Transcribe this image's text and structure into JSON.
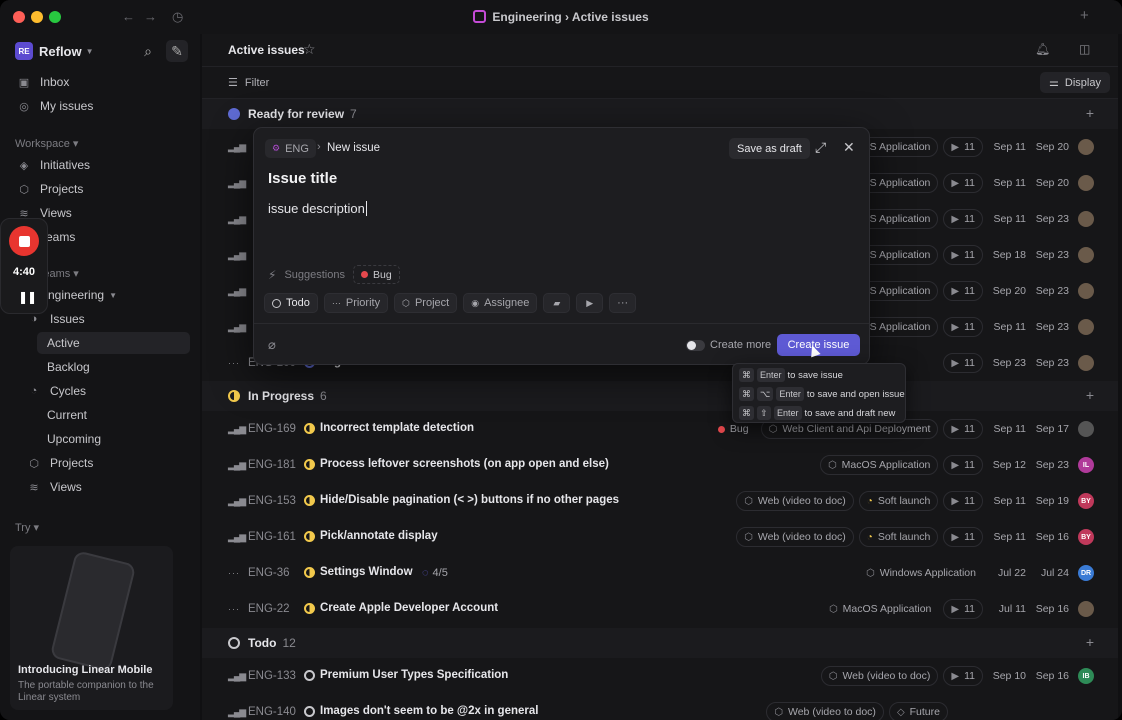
{
  "window": {
    "title": "Engineering › Active issues"
  },
  "sidebar": {
    "workspace_badge": "RE",
    "workspace_name": "Reflow",
    "inbox": "Inbox",
    "my_issues": "My issues",
    "workspace_section": "Workspace",
    "initiatives": "Initiatives",
    "projects": "Projects",
    "views": "Views",
    "teams": "Teams",
    "your_teams_section": "Your teams",
    "team_name": "Engineering",
    "issues": "Issues",
    "active": "Active",
    "backlog": "Backlog",
    "cycles": "Cycles",
    "current": "Current",
    "upcoming": "Upcoming",
    "team_projects": "Projects",
    "team_views": "Views",
    "try_section": "Try",
    "promo_title": "Introducing Linear Mobile",
    "promo_sub": "The portable companion to the Linear system"
  },
  "recorder": {
    "time": "4:40"
  },
  "header": {
    "title": "Active issues",
    "filter": "Filter",
    "display": "Display"
  },
  "groups": {
    "review": {
      "label": "Ready for review",
      "count": "7"
    },
    "progress": {
      "label": "In Progress",
      "count": "6"
    },
    "todo": {
      "label": "Todo",
      "count": "12"
    }
  },
  "review_rows": [
    {
      "project": "MacOS Application",
      "est": "11",
      "start": "Sep 11",
      "due": "Sep 20"
    },
    {
      "project": "MacOS Application",
      "est": "11",
      "start": "Sep 11",
      "due": "Sep 20"
    },
    {
      "project": "MacOS Application",
      "est": "11",
      "start": "Sep 11",
      "due": "Sep 23"
    },
    {
      "project": "MacOS Application",
      "est": "11",
      "start": "Sep 18",
      "due": "Sep 23"
    },
    {
      "project": "MacOS Application",
      "est": "11",
      "start": "Sep 20",
      "due": "Sep 23"
    },
    {
      "project": "MacOS Application",
      "est": "11",
      "start": "Sep 11",
      "due": "Sep 23"
    },
    {
      "id": "ENG-200",
      "title": "Login Screen",
      "est": "11",
      "start": "Sep 23",
      "due": "Sep 23"
    }
  ],
  "progress_rows": [
    {
      "id": "ENG-169",
      "title": "Incorrect template detection",
      "label": "Bug",
      "project": "Web Client and Api Deployment",
      "est": "11",
      "start": "Sep 11",
      "due": "Sep 17",
      "avatar": ""
    },
    {
      "id": "ENG-181",
      "title": "Process leftover screenshots (on app open and else)",
      "project": "MacOS Application",
      "est": "11",
      "start": "Sep 12",
      "due": "Sep 23",
      "avatar": "IL"
    },
    {
      "id": "ENG-153",
      "title": "Hide/Disable pagination (< >) buttons if no other pages",
      "project": "Web (video to doc)",
      "milestone": "Soft launch",
      "est": "11",
      "start": "Sep 11",
      "due": "Sep 19",
      "avatar": "BY"
    },
    {
      "id": "ENG-161",
      "title": "Pick/annotate display",
      "project": "Web (video to doc)",
      "milestone": "Soft launch",
      "est": "11",
      "start": "Sep 11",
      "due": "Sep 16",
      "avatar": "BY"
    },
    {
      "id": "ENG-36",
      "title": "Settings Window",
      "progress": "4/5",
      "project": "Windows Application",
      "start": "Jul 22",
      "due": "Jul 24",
      "avatar": "DR"
    },
    {
      "id": "ENG-22",
      "title": "Create Apple Developer Account",
      "project": "MacOS Application",
      "est": "11",
      "start": "Jul 11",
      "due": "Sep 16",
      "avatar": ""
    }
  ],
  "todo_rows": [
    {
      "id": "ENG-133",
      "title": "Premium User Types Specification",
      "project": "Web (video to doc)",
      "est": "11",
      "start": "Sep 10",
      "due": "Sep 16",
      "avatar": "IB"
    },
    {
      "id": "ENG-140",
      "title": "Images don't seem to be @2x in general",
      "project": "Web (video to doc)",
      "milestone": "Future"
    }
  ],
  "modal": {
    "team": "ENG",
    "crumb": "New issue",
    "save_draft": "Save as draft",
    "title": "Issue title",
    "description": "issue description",
    "suggestions": "Suggestions",
    "suggested_label": "Bug",
    "status": "Todo",
    "priority": "Priority",
    "project": "Project",
    "assignee": "Assignee",
    "more": "···",
    "create_more": "Create more",
    "create": "Create issue"
  },
  "tooltip": {
    "r1_keys": [
      "⌘",
      "Enter"
    ],
    "r1_text": "to save issue",
    "r2_keys": [
      "⌘",
      "⌥",
      "Enter"
    ],
    "r2_text": "to save and open issue",
    "r3_keys": [
      "⌘",
      "⇧",
      "Enter"
    ],
    "r3_text": "to save and draft new"
  },
  "colors": {
    "accent": "#5e5ad4",
    "review": "#5e6ad2",
    "progress": "#f2c94c",
    "bug": "#e5484d",
    "recording": "#e8352f"
  }
}
